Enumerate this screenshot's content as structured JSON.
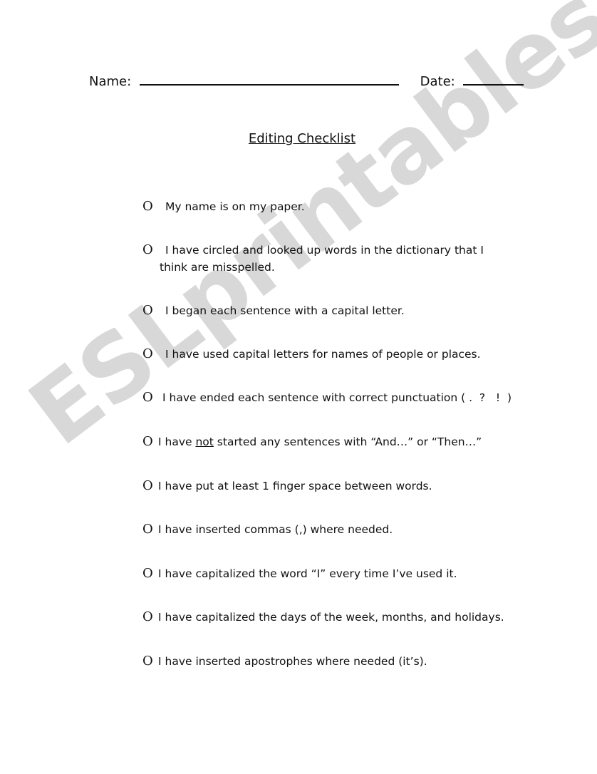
{
  "header": {
    "name_label": "Name:",
    "date_label": "Date:"
  },
  "title": "Editing Checklist",
  "watermark": "ESLprintables.com",
  "bullet_glyph": "O",
  "checklist": [
    {
      "text": "My name is on my paper."
    },
    {
      "line1": "I have circled and looked up words in the dictionary that I",
      "line2": "think are misspelled."
    },
    {
      "text": "I began each sentence with a capital letter."
    },
    {
      "text": "I have used capital letters for names of people or places."
    },
    {
      "text": "I have ended each sentence with correct punctuation ( .  ?   !  )"
    },
    {
      "pre": "I have ",
      "emph": "not",
      "post": " started any sentences with “And…” or “Then…”"
    },
    {
      "text": "I have put at least 1 finger space between words."
    },
    {
      "text": "I have inserted commas (,) where needed."
    },
    {
      "text": "I have capitalized the word “I” every time I’ve used it."
    },
    {
      "text": "I have capitalized the days of the week, months, and holidays."
    },
    {
      "text": "I have inserted apostrophes where needed (it’s)."
    }
  ]
}
